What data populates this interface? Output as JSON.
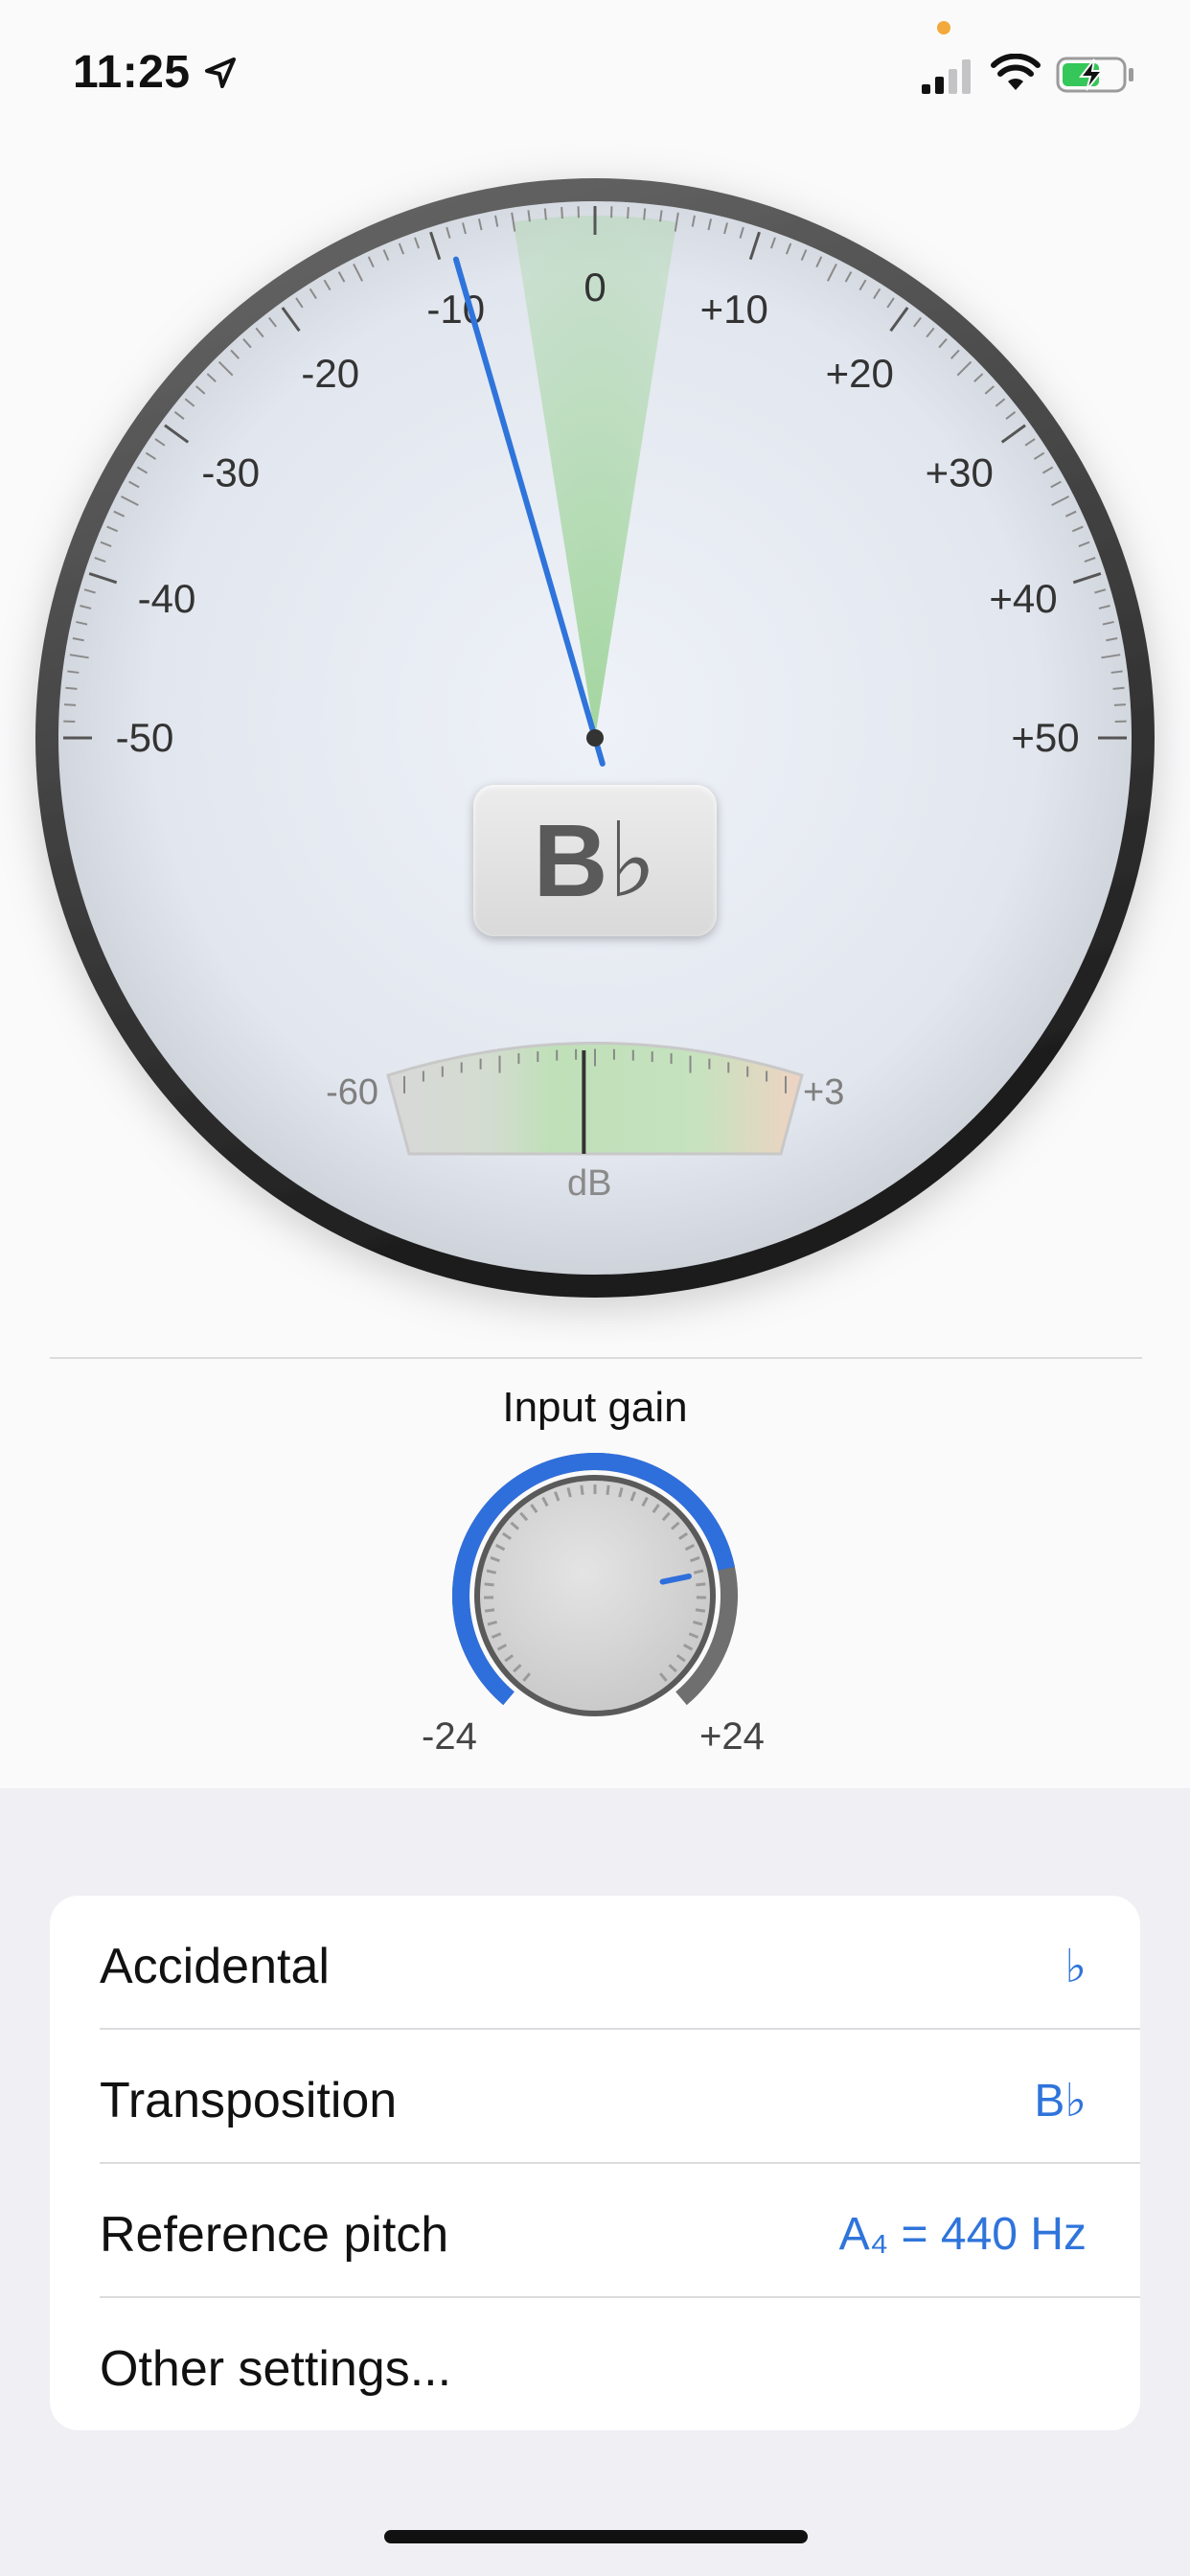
{
  "status_bar": {
    "time": "11:25",
    "icons": [
      "location-arrow-icon",
      "signal-icon",
      "wifi-icon",
      "battery-charging-icon"
    ],
    "privacy_dot_color": "#f3a93b"
  },
  "tuner": {
    "cents_labels": [
      "-50",
      "-40",
      "-30",
      "-20",
      "-10",
      "0",
      "+10",
      "+20",
      "+30",
      "+40",
      "+50"
    ],
    "cents_deviation": -9,
    "note": "B♭",
    "needle_color": "#2f74db",
    "in_tune_zone_color": "#9fd49a",
    "level_meter": {
      "min_label": "-60",
      "max_label": "+3",
      "unit": "dB",
      "level_fraction": 0.47
    }
  },
  "gain": {
    "title": "Input gain",
    "min_label": "-24",
    "max_label": "+24",
    "value_fraction": 0.78,
    "accent_color": "#2f6fdc"
  },
  "settings": [
    {
      "label": "Accidental",
      "value": "♭"
    },
    {
      "label": "Transposition",
      "value": "B♭"
    },
    {
      "label": "Reference pitch",
      "value": "A₄ = 440 Hz"
    },
    {
      "label": "Other settings...",
      "value": ""
    }
  ]
}
